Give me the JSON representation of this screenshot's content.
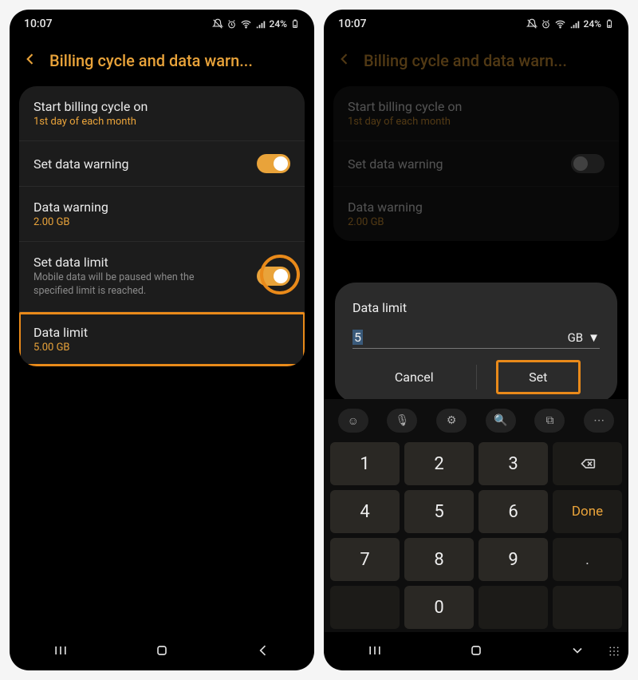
{
  "status": {
    "time": "10:07",
    "battery": "24%"
  },
  "header": {
    "title": "Billing cycle and data warn..."
  },
  "settings": {
    "billing": {
      "label": "Start billing cycle on",
      "sub": "1st day of each month"
    },
    "warnToggle": {
      "label": "Set data warning"
    },
    "warning": {
      "label": "Data warning",
      "sub": "2.00 GB"
    },
    "limitToggle": {
      "label": "Set data limit",
      "desc": "Mobile data will be paused when the specified limit is reached."
    },
    "limit": {
      "label": "Data limit",
      "sub": "5.00 GB"
    }
  },
  "dialog": {
    "title": "Data limit",
    "value": "5",
    "unit": "GB",
    "cancel": "Cancel",
    "set": "Set"
  },
  "keypad": {
    "tools": [
      "☺",
      "🎙",
      "⚙",
      "🔍",
      "⧉",
      "⋯"
    ],
    "rows": [
      [
        "1",
        "2",
        "3",
        "⌫"
      ],
      [
        "4",
        "5",
        "6",
        "Done"
      ],
      [
        "7",
        "8",
        "9",
        "."
      ],
      [
        "",
        "0",
        "",
        ""
      ]
    ]
  }
}
